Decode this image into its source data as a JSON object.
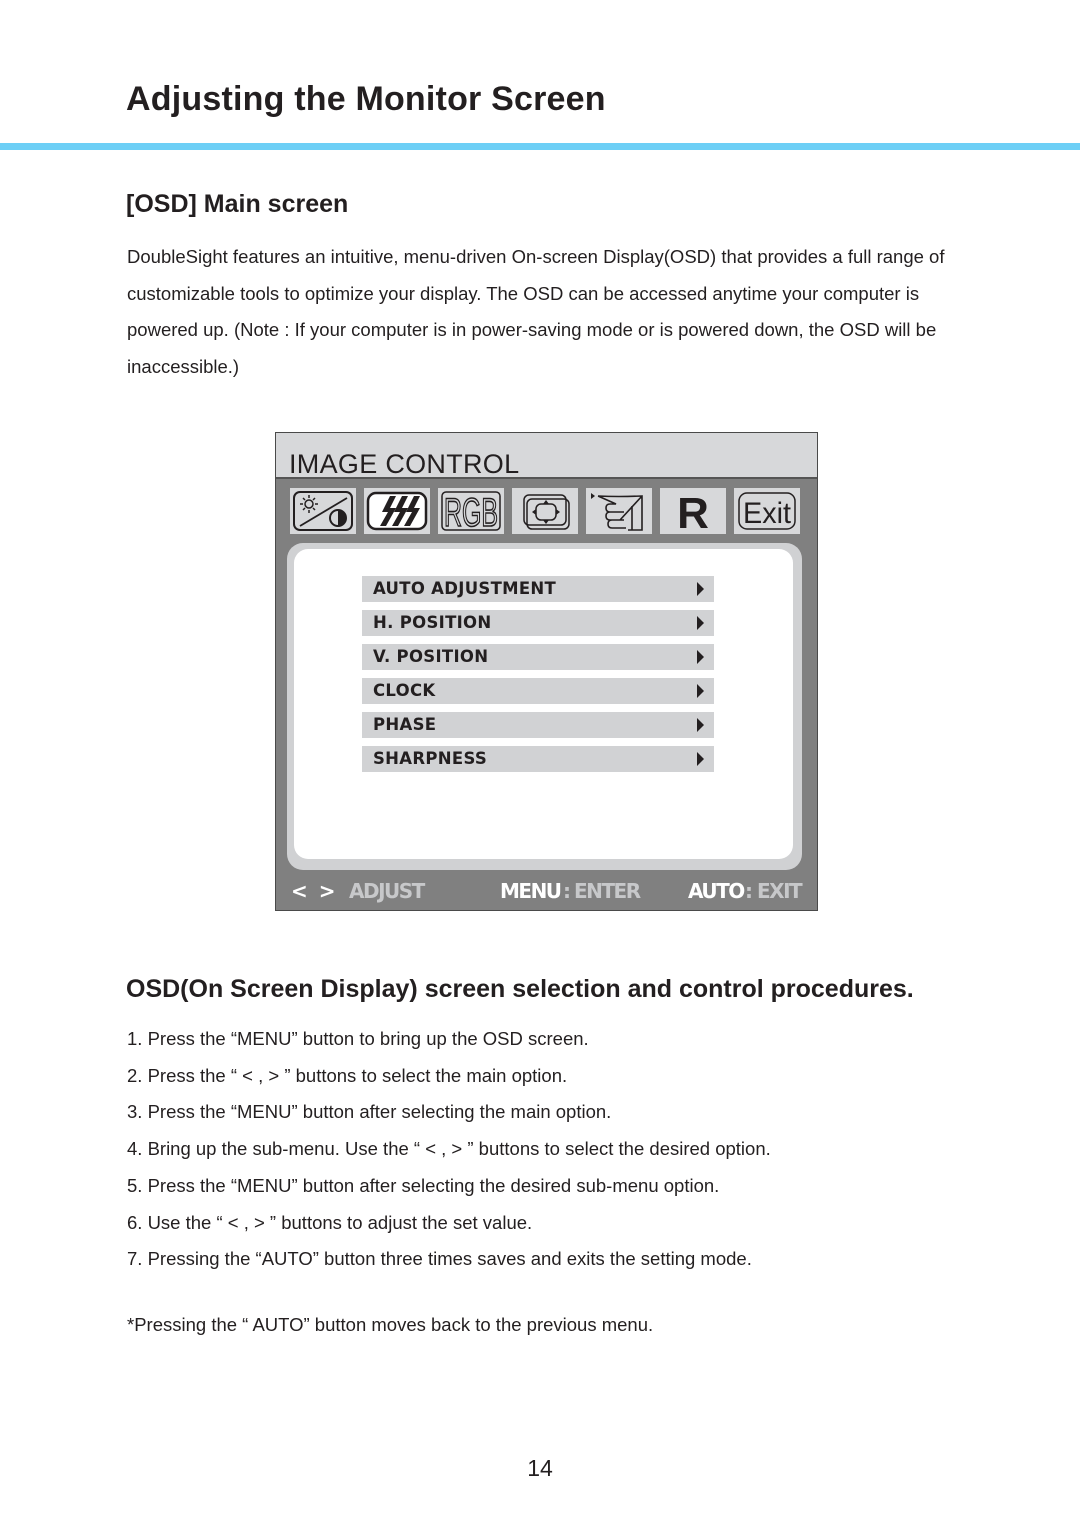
{
  "page": {
    "title": "Adjusting the Monitor Screen",
    "accent_color": "#6dcff6",
    "page_number": "14"
  },
  "section1": {
    "heading": "[OSD] Main screen",
    "intro": "DoubleSight features an intuitive, menu-driven On-screen Display(OSD) that provides a full range of customizable tools to optimize your display. The OSD can be accessed anytime your computer is powered up. (Note : If your computer is in power-saving mode or is powered down, the OSD will be inaccessible.)"
  },
  "osd": {
    "title": "IMAGE CONTROL",
    "colors": {
      "frame": "#808080",
      "bar": "#d7d8da",
      "item": "#d1d2d4"
    },
    "icons": [
      {
        "name": "brightness-contrast-icon"
      },
      {
        "name": "color-temperature-icon"
      },
      {
        "name": "rgb-icon",
        "text": "RGB"
      },
      {
        "name": "position-icon"
      },
      {
        "name": "osd-setup-icon"
      },
      {
        "name": "reset-icon",
        "text": "R"
      },
      {
        "name": "exit-icon",
        "text": "Exit"
      }
    ],
    "menu_items": [
      {
        "label": "AUTO ADJUSTMENT"
      },
      {
        "label": "H. POSITION"
      },
      {
        "label": "V. POSITION"
      },
      {
        "label": "CLOCK"
      },
      {
        "label": "PHASE"
      },
      {
        "label": "SHARPNESS"
      }
    ],
    "footer": {
      "arrows": "< >",
      "adjust": "ADJUST",
      "menu_key": "MENU",
      "menu_sep": ":",
      "menu_action": "ENTER",
      "auto_key": "AUTO",
      "auto_sep": ":",
      "auto_action": "EXIT"
    }
  },
  "section2": {
    "heading": "OSD(On Screen Display) screen selection and control procedures.",
    "steps": [
      "1. Press the “MENU” button to bring up the OSD screen.",
      "2. Press the “ < , > ” buttons to select the main option.",
      "3. Press the “MENU” button after selecting the main option.",
      "4. Bring up the sub-menu. Use the “ < , > ” buttons to select the desired option.",
      "5. Press the “MENU” button after selecting the desired sub-menu option.",
      "6. Use the “ < , > ” buttons to adjust the set value.",
      "7. Pressing the “AUTO” button three times saves and exits the setting mode."
    ],
    "note": "*Pressing the “ AUTO” button moves back to the previous menu."
  }
}
